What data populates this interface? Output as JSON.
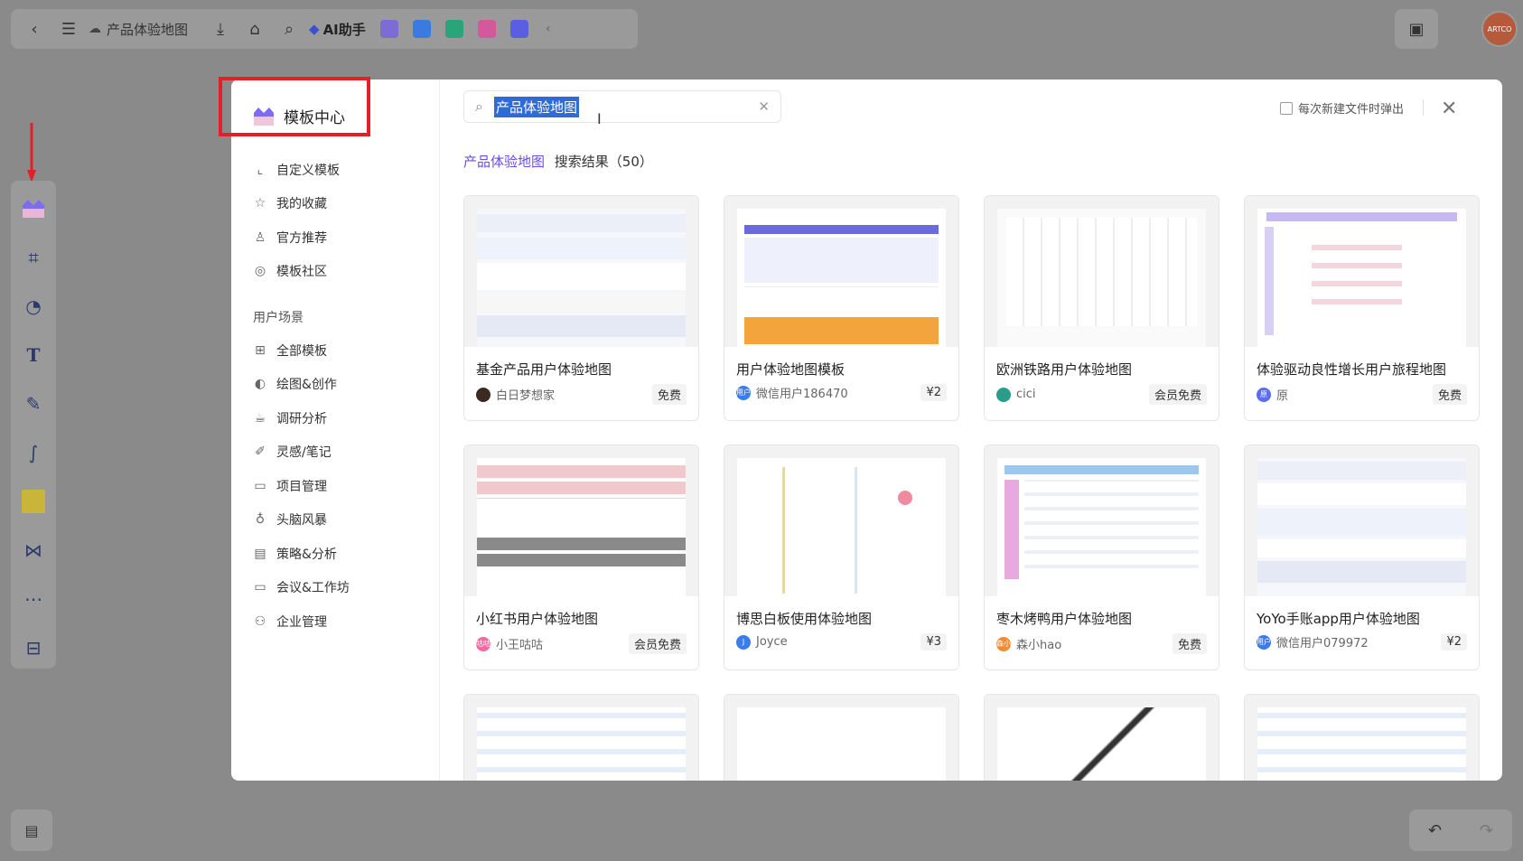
{
  "topbar": {
    "doc_title": "产品体验地图",
    "ai_label": "AI助手"
  },
  "avatar_text": "ARTCO",
  "modal": {
    "brand": "模板中心",
    "nav_top": [
      {
        "label": "自定义模板",
        "icon": "chart-icon"
      },
      {
        "label": "我的收藏",
        "icon": "star-icon"
      },
      {
        "label": "官方推荐",
        "icon": "thumb-up-icon"
      },
      {
        "label": "模板社区",
        "icon": "planet-icon"
      }
    ],
    "section_title": "用户场景",
    "nav_scenes": [
      {
        "label": "全部模板",
        "icon": "grid-icon"
      },
      {
        "label": "绘图&创作",
        "icon": "palette-icon"
      },
      {
        "label": "调研分析",
        "icon": "cup-icon"
      },
      {
        "label": "灵感/笔记",
        "icon": "pen-icon"
      },
      {
        "label": "项目管理",
        "icon": "clipboard-icon"
      },
      {
        "label": "头脑风暴",
        "icon": "bulb-icon"
      },
      {
        "label": "策略&分析",
        "icon": "briefcase-icon"
      },
      {
        "label": "会议&工作坊",
        "icon": "meeting-icon"
      },
      {
        "label": "企业管理",
        "icon": "org-icon"
      }
    ],
    "search_value": "产品体验地图",
    "popup_label": "每次新建文件时弹出",
    "result_keyword": "产品体验地图",
    "result_text": "搜索结果（50）",
    "cards": [
      {
        "title": "基金产品用户体验地图",
        "author": "白日梦想家",
        "price": "免费",
        "av_color": "#3a2a22",
        "av_text": ""
      },
      {
        "title": "用户体验地图模板",
        "author": "微信用户186470",
        "price": "¥2",
        "av_color": "#3b7bea",
        "av_text": "用户"
      },
      {
        "title": "欧洲铁路用户体验地图",
        "author": "cici",
        "price": "会员免费",
        "av_color": "#2a9c8a",
        "av_text": ""
      },
      {
        "title": "体验驱动良性增长用户旅程地图",
        "author": "原",
        "price": "免费",
        "av_color": "#5a6cf0",
        "av_text": "原"
      },
      {
        "title": "小红书用户体验地图",
        "author": "小王咕咕",
        "price": "会员免费",
        "av_color": "#ef6aa0",
        "av_text": "咕咕"
      },
      {
        "title": "博思白板使用体验地图",
        "author": "Joyce",
        "price": "¥3",
        "av_color": "#3b7bea",
        "av_text": "J"
      },
      {
        "title": "枣木烤鸭用户体验地图",
        "author": "森小hao",
        "price": "免费",
        "av_color": "#f28b30",
        "av_text": "森小"
      },
      {
        "title": "YoYo手账app用户体验地图",
        "author": "微信用户079972",
        "price": "¥2",
        "av_color": "#3b7bea",
        "av_text": "用户"
      }
    ]
  }
}
